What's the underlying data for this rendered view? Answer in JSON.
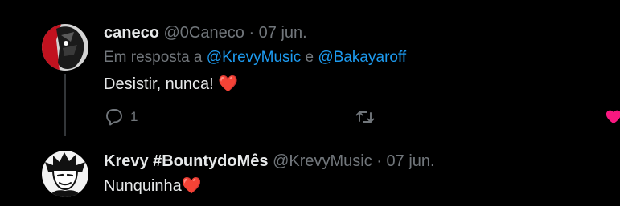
{
  "reply_tweet": {
    "display_name": "caneco",
    "handle": "@0Caneco",
    "separator": "·",
    "date": "07 jun.",
    "reply_prefix": "Em resposta a",
    "mention_1": "@KrevyMusic",
    "reply_conjunction": "e",
    "mention_2": "@Bakayaroff",
    "text": "Desistir, nunca!",
    "text_emoji": "❤️",
    "actions": {
      "reply_icon": "reply-icon",
      "reply_count": "1",
      "retweet_icon": "retweet-icon",
      "like_icon": "heart-icon"
    }
  },
  "second_tweet": {
    "display_name": "Krevy #BountydoMês",
    "handle": "@KrevyMusic",
    "separator": "·",
    "date": "07 jun.",
    "text": "Nunquinha",
    "text_emoji": "❤️"
  },
  "colors": {
    "background": "#000000",
    "text": "#e7e9ea",
    "muted": "#71767b",
    "mention": "#1d9bf0",
    "like": "#f91880"
  }
}
